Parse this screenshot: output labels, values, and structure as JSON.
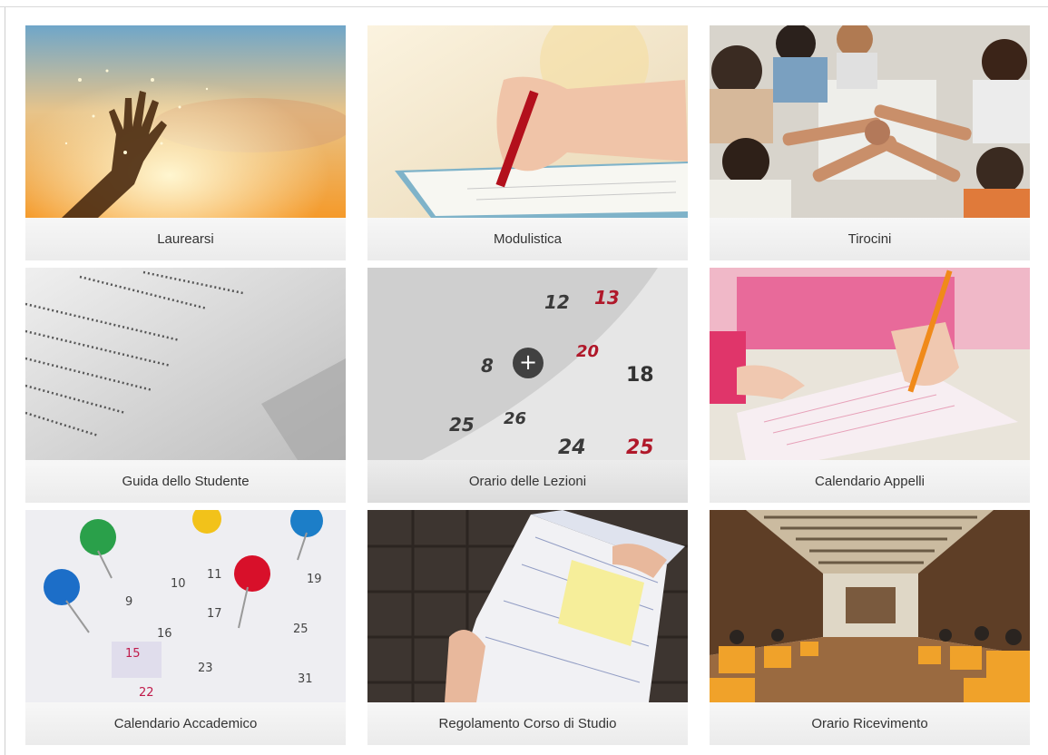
{
  "cards": [
    {
      "label": "Laurearsi",
      "image": "hand-reaching-sunset-image"
    },
    {
      "label": "Modulistica",
      "image": "hand-writing-form-image"
    },
    {
      "label": "Tirocini",
      "image": "team-stacking-hands-image"
    },
    {
      "label": "Guida dello Studente",
      "image": "printed-index-pages-image"
    },
    {
      "label": "Orario delle Lezioni",
      "image": "calendar-pages-image",
      "hover_icon": "+"
    },
    {
      "label": "Calendario Appelli",
      "image": "student-exam-answer-sheet-image"
    },
    {
      "label": "Calendario Accademico",
      "image": "calendar-with-push-pins-image"
    },
    {
      "label": "Regolamento Corso di Studio",
      "image": "open-notebook-image"
    },
    {
      "label": "Orario Ricevimento",
      "image": "library-hall-image"
    }
  ],
  "colors": {
    "caption_bg": "#f1f1f1",
    "caption_text": "#333333",
    "page_bg": "#ffffff"
  }
}
